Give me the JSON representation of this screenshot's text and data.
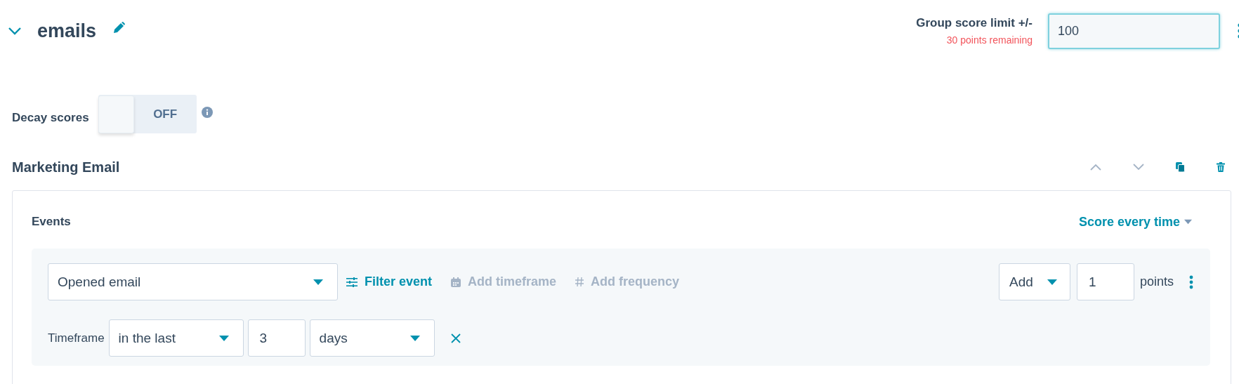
{
  "group": {
    "title": "emails",
    "expanded": true,
    "score_limit": {
      "label": "Group score limit +/-",
      "remaining": "30 points remaining",
      "value": "100"
    }
  },
  "decay": {
    "label": "Decay scores",
    "toggle": {
      "label": "OFF",
      "on": false
    }
  },
  "section": {
    "title": "Marketing Email",
    "card": {
      "heading": "Events",
      "mode": "Score every time",
      "rules": [
        {
          "event": "Opened email",
          "actions": [
            {
              "kind": "filter",
              "label": "Filter event",
              "disabled": false
            },
            {
              "kind": "timeframe",
              "label": "Add timeframe",
              "disabled": true
            },
            {
              "kind": "frequency",
              "label": "Add frequency",
              "disabled": true
            }
          ],
          "operation": "Add",
          "points": "1",
          "points_label": "points",
          "timeframe": {
            "label": "Timeframe",
            "range": "in the last",
            "amount": "3",
            "unit": "days"
          }
        }
      ]
    }
  }
}
